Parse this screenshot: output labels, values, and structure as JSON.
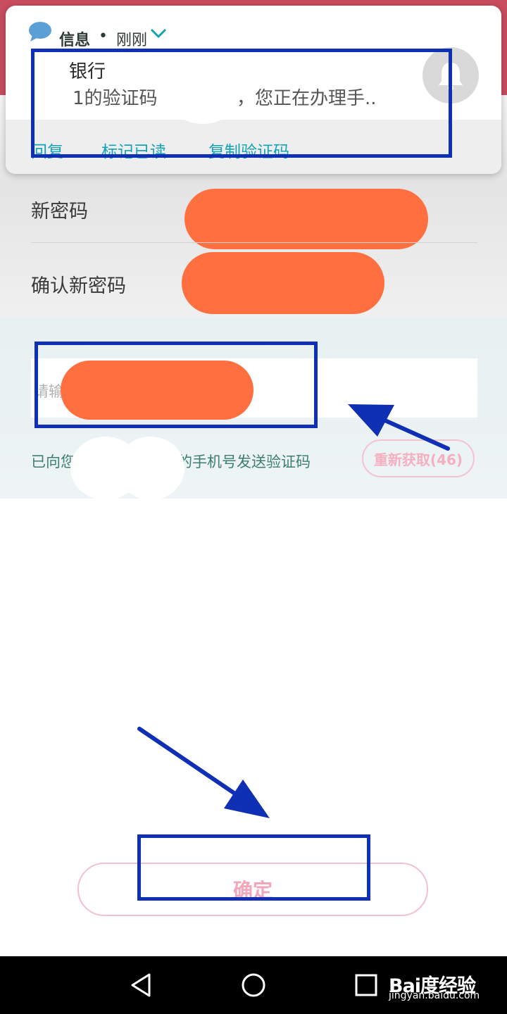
{
  "notification": {
    "app_name": "信息",
    "separator": "•",
    "time": "刚刚",
    "sender": "银行",
    "body_lead": "1的验证码",
    "body_tail": "，您正在办理手..",
    "actions": [
      "回复",
      "标记已读",
      "复制验证码"
    ]
  },
  "form": {
    "new_password_label": "新密码",
    "confirm_password_label": "确认新密码",
    "code_placeholder": "请输",
    "sent_hint_start": "已向您",
    "sent_hint_end": "的手机号发送验证码",
    "resend_label": "重新获取(46)"
  },
  "confirm_label": "确定",
  "watermark": {
    "logo_text": "Bai度经验",
    "url": "jingyan.baidu.com"
  },
  "colors": {
    "annotation_blue": "#0f2fb4",
    "redaction_orange": "#ff6f3f",
    "action_teal": "#14a3b4",
    "button_pink": "#f2a6b9",
    "header_red": "#c84d5f"
  }
}
